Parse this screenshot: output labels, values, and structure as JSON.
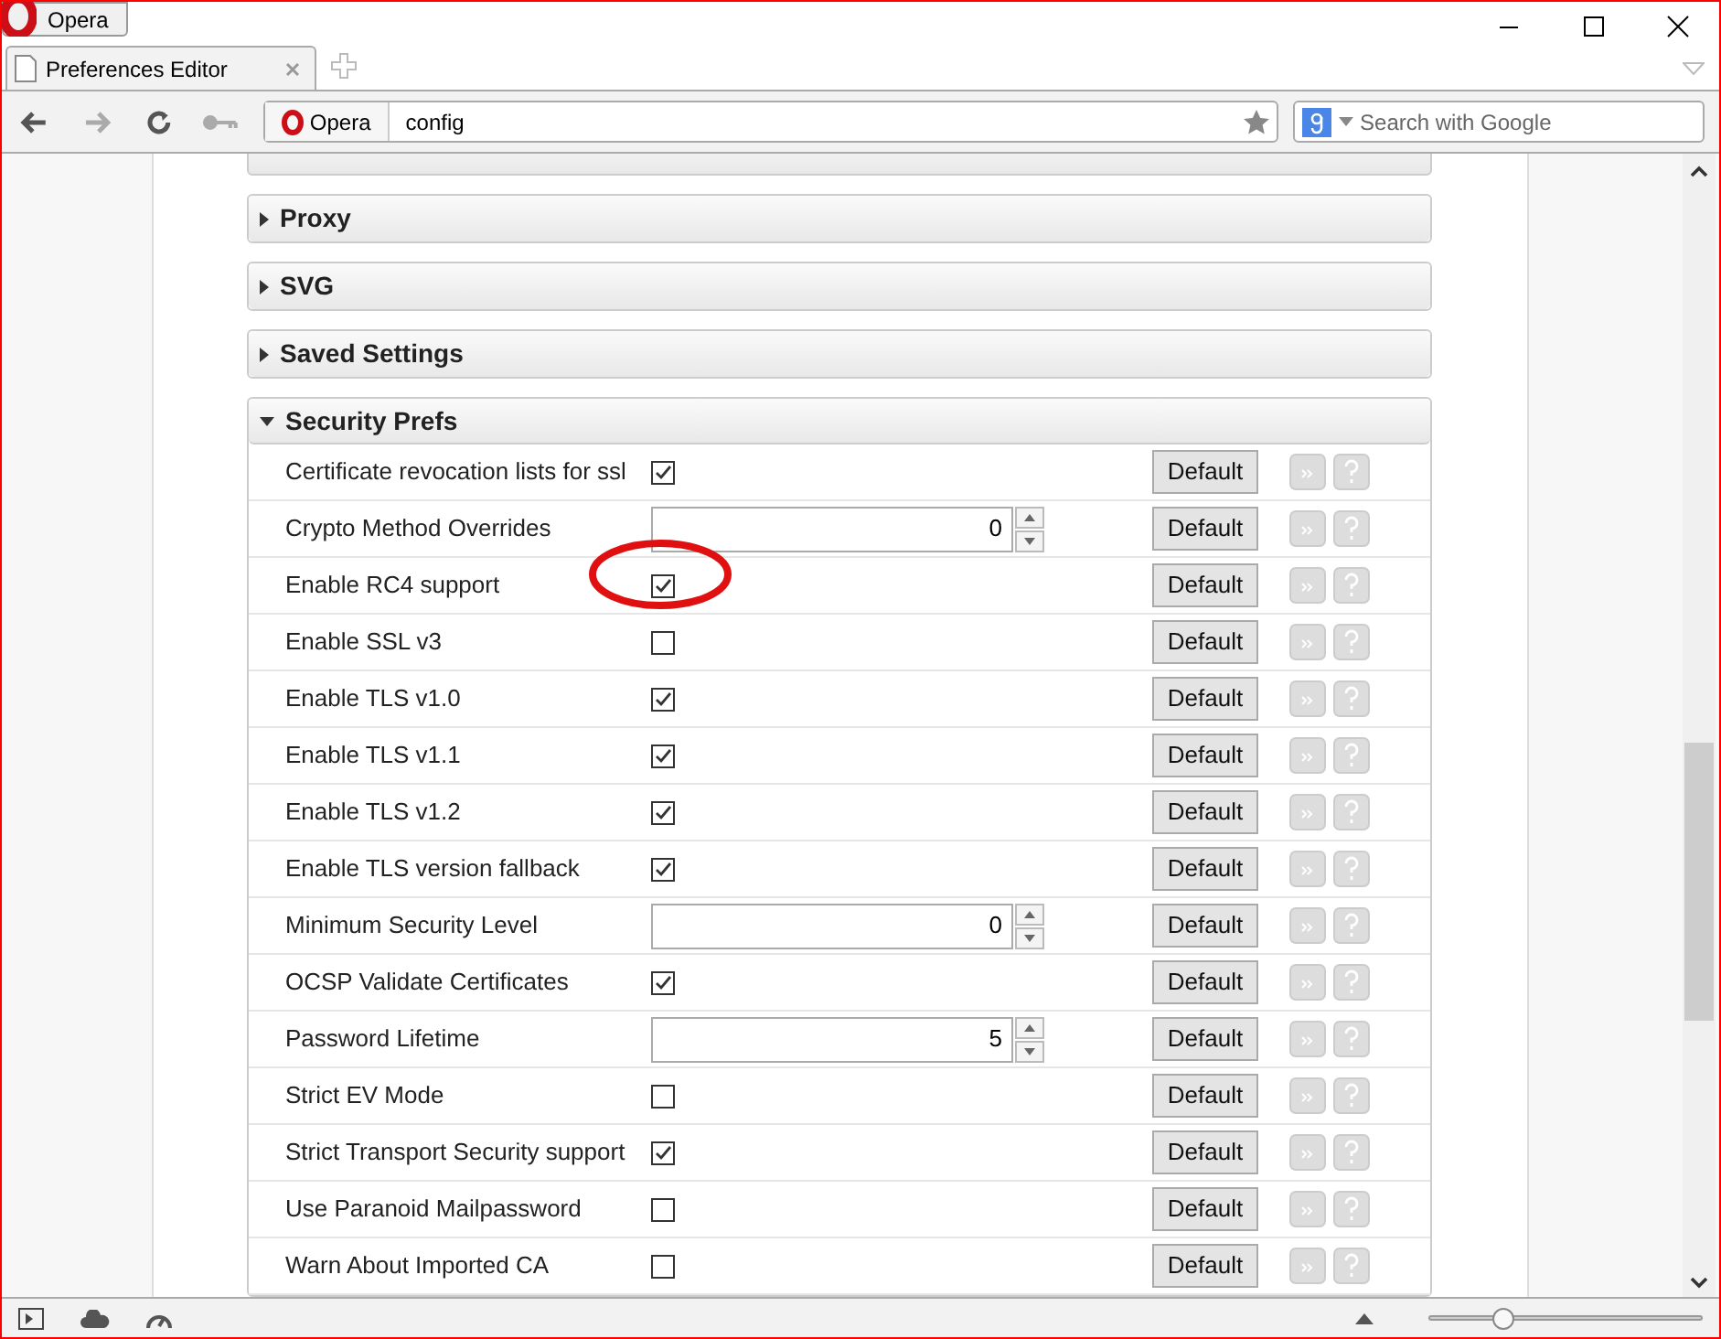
{
  "menu_button": {
    "label": "Opera"
  },
  "tabs": [
    {
      "title": "Preferences Editor",
      "selected": true
    }
  ],
  "address_bar": {
    "badge": "Opera",
    "value": "config"
  },
  "search": {
    "placeholder": "Search with Google"
  },
  "sections": [
    {
      "title": "Proxy",
      "expanded": false
    },
    {
      "title": "SVG",
      "expanded": false
    },
    {
      "title": "Saved Settings",
      "expanded": false
    },
    {
      "title": "Security Prefs",
      "expanded": true,
      "rows": [
        {
          "label": "Certificate revocation lists for ssl",
          "kind": "checkbox",
          "checked": true,
          "highlighted": false,
          "button": "Default"
        },
        {
          "label": "Crypto Method Overrides",
          "kind": "number",
          "value": "0",
          "highlighted": false,
          "button": "Default"
        },
        {
          "label": "Enable RC4 support",
          "kind": "checkbox",
          "checked": true,
          "highlighted": true,
          "button": "Default"
        },
        {
          "label": "Enable SSL v3",
          "kind": "checkbox",
          "checked": false,
          "highlighted": false,
          "button": "Default"
        },
        {
          "label": "Enable TLS v1.0",
          "kind": "checkbox",
          "checked": true,
          "highlighted": false,
          "button": "Default"
        },
        {
          "label": "Enable TLS v1.1",
          "kind": "checkbox",
          "checked": true,
          "highlighted": false,
          "button": "Default"
        },
        {
          "label": "Enable TLS v1.2",
          "kind": "checkbox",
          "checked": true,
          "highlighted": false,
          "button": "Default"
        },
        {
          "label": "Enable TLS version fallback",
          "kind": "checkbox",
          "checked": true,
          "highlighted": false,
          "button": "Default"
        },
        {
          "label": "Minimum Security Level",
          "kind": "number",
          "value": "0",
          "highlighted": false,
          "button": "Default"
        },
        {
          "label": "OCSP Validate Certificates",
          "kind": "checkbox",
          "checked": true,
          "highlighted": false,
          "button": "Default"
        },
        {
          "label": "Password Lifetime",
          "kind": "number",
          "value": "5",
          "highlighted": false,
          "button": "Default"
        },
        {
          "label": "Strict EV Mode",
          "kind": "checkbox",
          "checked": false,
          "highlighted": false,
          "button": "Default"
        },
        {
          "label": "Strict Transport Security support",
          "kind": "checkbox",
          "checked": true,
          "highlighted": false,
          "button": "Default"
        },
        {
          "label": "Use Paranoid Mailpassword",
          "kind": "checkbox",
          "checked": false,
          "highlighted": false,
          "button": "Default"
        },
        {
          "label": "Warn About Imported CA",
          "kind": "checkbox",
          "checked": false,
          "highlighted": false,
          "button": "Default"
        }
      ]
    }
  ],
  "zoom_slider": {
    "level": 0.27
  }
}
